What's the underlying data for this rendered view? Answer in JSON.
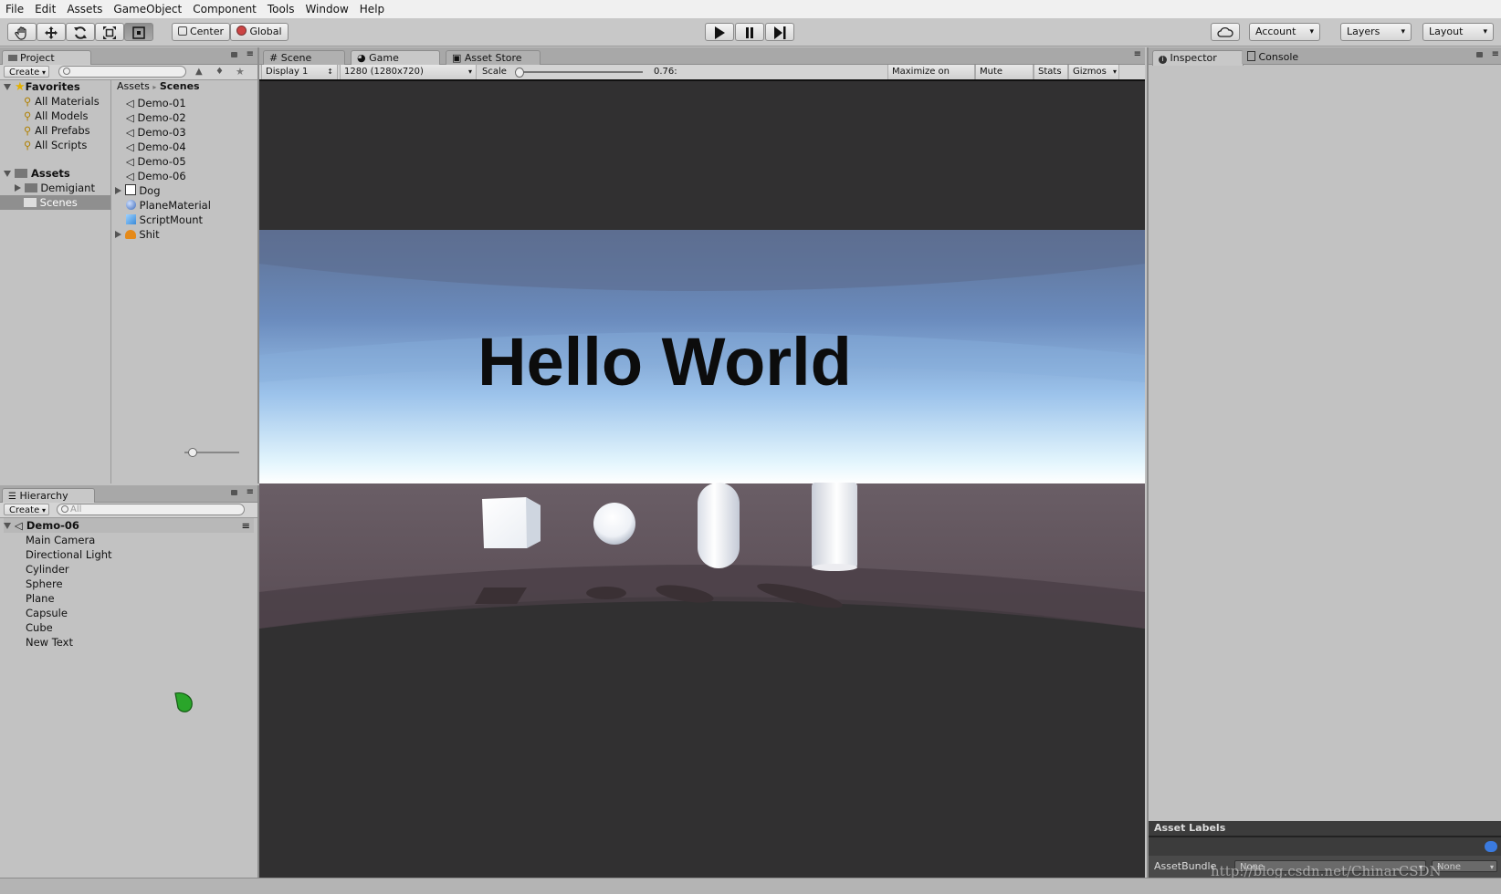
{
  "menu": [
    "File",
    "Edit",
    "Assets",
    "GameObject",
    "Component",
    "Tools",
    "Window",
    "Help"
  ],
  "toolbar": {
    "tools": [
      "hand-icon",
      "move-icon",
      "rotate-icon",
      "scale-icon",
      "rect-icon"
    ],
    "pivot_label": "Center",
    "space_label": "Global",
    "account_label": "Account",
    "layers_label": "Layers",
    "layout_label": "Layout"
  },
  "project": {
    "tab": "Project",
    "create_label": "Create",
    "favorites_label": "Favorites",
    "favorites": [
      "All Materials",
      "All Models",
      "All Prefabs",
      "All Scripts"
    ],
    "assets_label": "Assets",
    "folders": [
      "Demigiant",
      "Scenes"
    ],
    "breadcrumb": [
      "Assets",
      "Scenes"
    ],
    "files": [
      "Demo-01",
      "Demo-02",
      "Demo-03",
      "Demo-04",
      "Demo-05",
      "Demo-06",
      "Dog",
      "PlaneMaterial",
      "ScriptMount",
      "Shit"
    ]
  },
  "hierarchy": {
    "tab": "Hierarchy",
    "create_label": "Create",
    "search_placeholder": "All",
    "scene": "Demo-06",
    "items": [
      "Main Camera",
      "Directional Light",
      "Cylinder",
      "Sphere",
      "Plane",
      "Capsule",
      "Cube",
      "New Text"
    ]
  },
  "center": {
    "tabs": [
      "Scene",
      "Game",
      "Asset Store"
    ],
    "display": "Display 1",
    "resolution": "1280 (1280x720)",
    "scale_label": "Scale",
    "scale_value": "0.76:",
    "scale_fraction": 0.76,
    "buttons": [
      "Maximize on Play",
      "Mute audio",
      "Stats",
      "Gizmos"
    ],
    "scene_text": "Hello World"
  },
  "inspector": {
    "tabs": [
      "Inspector",
      "Console"
    ],
    "asset_labels": "Asset Labels",
    "asset_bundle_label": "AssetBundle",
    "bundle_values": [
      "None",
      "None"
    ],
    "watermark": "http://blog.csdn.net/ChinarCSDN"
  }
}
